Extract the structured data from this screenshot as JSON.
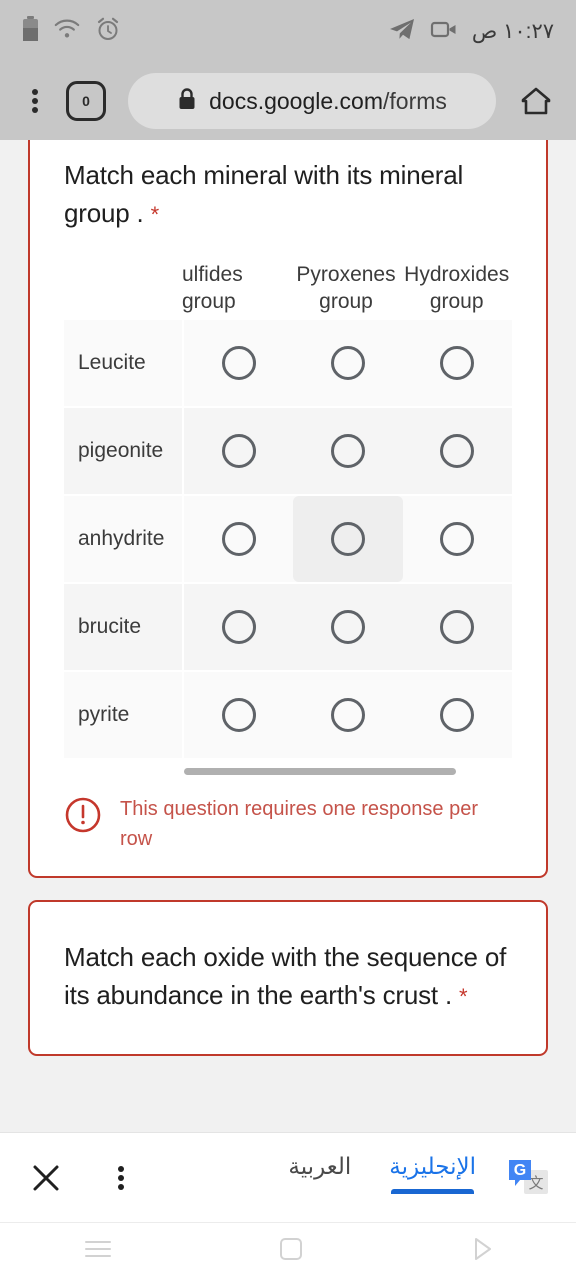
{
  "statusbar": {
    "time": "١٠:٢٧ ص",
    "icons": [
      "battery-icon",
      "wifi-icon",
      "alarm-icon",
      "telegram-icon",
      "video-camera-icon"
    ]
  },
  "browser": {
    "menu_label": "more-options",
    "tab_count": "0",
    "url_prefix": "docs.google.com",
    "url_suffix": "/forms",
    "lock_label": "secure",
    "home_label": "Home"
  },
  "questions": [
    {
      "title": "Match each mineral with its mineral group .",
      "required_mark": "*",
      "columns": [
        {
          "line1": "ulfides",
          "line2": "group",
          "clipped": true
        },
        {
          "line1": "Pyroxenes",
          "line2": "group",
          "clipped": false
        },
        {
          "line1": "Hydroxides",
          "line2": "group",
          "clipped": false
        }
      ],
      "rows": [
        {
          "label": "Leucite",
          "highlight": -1
        },
        {
          "label": "pigeonite",
          "highlight": -1
        },
        {
          "label": "anhydrite",
          "highlight": 1
        },
        {
          "label": "brucite",
          "highlight": -1
        },
        {
          "label": "pyrite",
          "highlight": -1
        }
      ],
      "error": "This question requires one response per row"
    },
    {
      "title": "Match each oxide with the sequence of its abundance in the earth's crust .",
      "required_mark": "*"
    }
  ],
  "translate_bar": {
    "close_label": "close",
    "menu_label": "more-options",
    "languages": [
      {
        "label": "العربية",
        "active": false
      },
      {
        "label": "الإنجليزية",
        "active": true
      }
    ],
    "logo_label": "google-translate"
  },
  "navbar": {
    "items": [
      "recents",
      "home",
      "back"
    ]
  },
  "colors": {
    "error_border": "#c0392b",
    "error_text": "#c5534a",
    "accent_blue": "#1a73e8",
    "radio_outline": "#5f6368"
  }
}
